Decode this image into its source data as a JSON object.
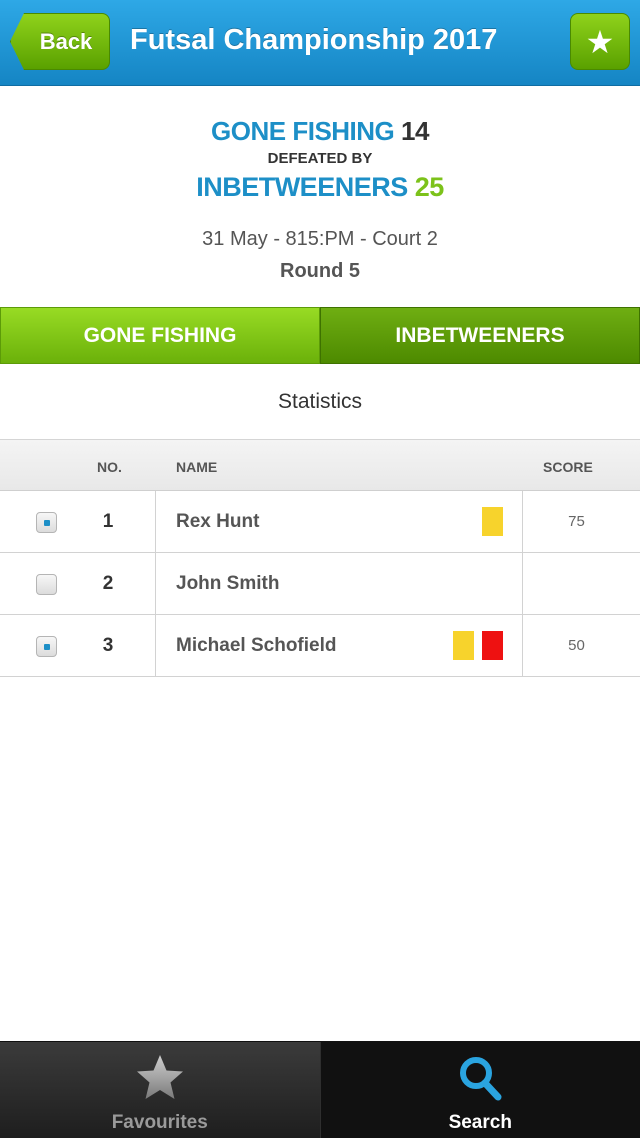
{
  "header": {
    "back_label": "Back",
    "title": "Futsal Championship 2017",
    "favourite_icon": "star-icon"
  },
  "match": {
    "team1_name": "GONE FISHING",
    "team1_score": "14",
    "result_text": "DEFEATED BY",
    "team2_name": "INBETWEENERS",
    "team2_score": "25",
    "info": "31 May - 815:PM - Court 2",
    "round": "Round 5"
  },
  "team_tabs": [
    {
      "label": "GONE FISHING",
      "active": true
    },
    {
      "label": "INBETWEENERS",
      "active": false
    }
  ],
  "statistics_label": "Statistics",
  "table": {
    "columns": {
      "no": "NO.",
      "name": "NAME",
      "score": "SCORE"
    },
    "rows": [
      {
        "checked": true,
        "no": "1",
        "name": "Rex Hunt",
        "cards": [
          "yellow"
        ],
        "score": "75"
      },
      {
        "checked": false,
        "no": "2",
        "name": "John Smith",
        "cards": [],
        "score": ""
      },
      {
        "checked": true,
        "no": "3",
        "name": "Michael Schofield",
        "cards": [
          "yellow",
          "red"
        ],
        "score": "50"
      }
    ]
  },
  "colors": {
    "header_blue": "#1d8fc7",
    "accent_green": "#7cc21a",
    "yellow_card": "#f7d32c",
    "red_card": "#ee1111"
  },
  "tabbar": {
    "items": [
      {
        "label": "Favourites",
        "icon": "star-icon",
        "selected": false
      },
      {
        "label": "Search",
        "icon": "search-icon",
        "selected": true
      }
    ]
  }
}
